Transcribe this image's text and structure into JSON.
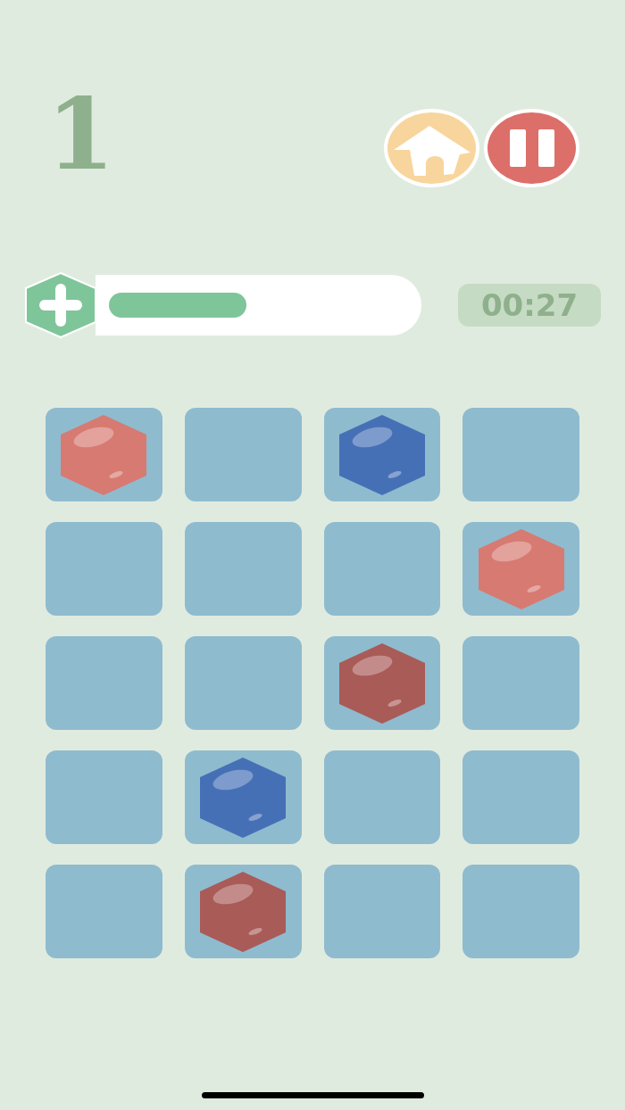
{
  "score": "1",
  "buttons": [
    {
      "kind": "home"
    },
    {
      "kind": "pause"
    }
  ],
  "timer": "00:27",
  "board": [
    [
      {
        "kind": "gem",
        "color": "#d77a72"
      },
      {
        "kind": "empty"
      },
      {
        "kind": "gem",
        "color": "#4670b6"
      },
      {
        "kind": "empty"
      }
    ],
    [
      {
        "kind": "empty"
      },
      {
        "kind": "empty"
      },
      {
        "kind": "empty"
      },
      {
        "kind": "gem",
        "color": "#d77a72"
      }
    ],
    [
      {
        "kind": "empty"
      },
      {
        "kind": "empty"
      },
      {
        "kind": "gem",
        "color": "#a95b58"
      },
      {
        "kind": "empty"
      }
    ],
    [
      {
        "kind": "empty"
      },
      {
        "kind": "gem",
        "color": "#4670b6"
      },
      {
        "kind": "empty"
      },
      {
        "kind": "empty"
      }
    ],
    [
      {
        "kind": "empty"
      },
      {
        "kind": "gem",
        "color": "#a95b58"
      },
      {
        "kind": "empty"
      },
      {
        "kind": "empty"
      }
    ]
  ]
}
